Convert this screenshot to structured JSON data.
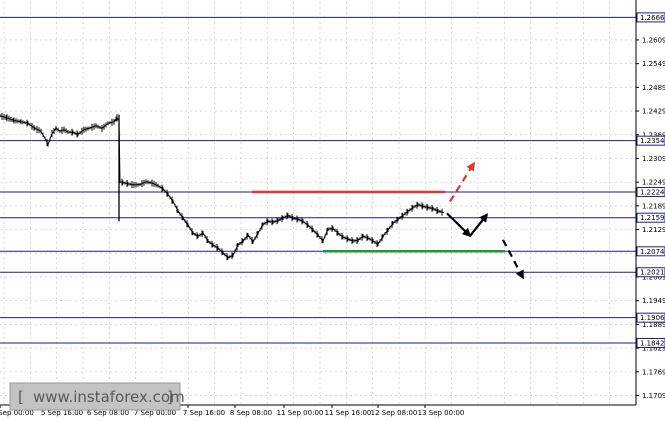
{
  "chart_data": {
    "type": "line",
    "title": "",
    "xlabel": "",
    "ylabel": "",
    "ylim": [
      1.1685,
      1.2705
    ],
    "y_ticks": [
      "1.2666",
      "1.2609",
      "1.2549",
      "1.2489",
      "1.2429",
      "1.2369",
      "1.2309",
      "1.2249",
      "1.2189",
      "1.2129",
      "1.2069",
      "1.2009",
      "1.1949",
      "1.1889",
      "1.1829",
      "1.1769",
      "1.1709"
    ],
    "x_ticks": [
      "4 Sep 00:00",
      "5 Sep 16:00",
      "6 Sep 08:00",
      "7 Sep 00:00",
      "7 Sep 16:00",
      "8 Sep 08:00",
      "11 Sep 00:00",
      "11 Sep 16:00",
      "12 Sep 08:00",
      "13 Sep 00:00"
    ],
    "x_tick_display": [
      "Sep 00:00",
      "5 Sep 16:00",
      "6 Sep 08:00",
      "7 Sep 00:00",
      "7 Sep 16:00",
      "8 Sep 08:00",
      "11 Sep 00:00",
      "11 Sep 16:00",
      "12 Sep 08:00",
      "13 Sep 00:00"
    ],
    "grid": true,
    "levels": [
      {
        "value": 1.2666,
        "label": "1.2666"
      },
      {
        "value": 1.2354,
        "label": "1.2354"
      },
      {
        "value": 1.2224,
        "label": "1.2224"
      },
      {
        "value": 1.2159,
        "label": "1.2159"
      },
      {
        "value": 1.2074,
        "label": "1.2074"
      },
      {
        "value": 1.2021,
        "label": "1.2021"
      },
      {
        "value": 1.1906,
        "label": "1.1906"
      },
      {
        "value": 1.1842,
        "label": "1.1842"
      }
    ],
    "price": [
      [
        0,
        1.2417
      ],
      [
        7,
        1.2412
      ],
      [
        14,
        1.2405
      ],
      [
        21,
        1.2402
      ],
      [
        28,
        1.2398
      ],
      [
        35,
        1.2385
      ],
      [
        41,
        1.2378
      ],
      [
        45,
        1.236
      ],
      [
        48,
        1.2344
      ],
      [
        52,
        1.2372
      ],
      [
        56,
        1.2385
      ],
      [
        60,
        1.2378
      ],
      [
        64,
        1.2382
      ],
      [
        68,
        1.2376
      ],
      [
        73,
        1.2375
      ],
      [
        78,
        1.237
      ],
      [
        84,
        1.2382
      ],
      [
        90,
        1.2386
      ],
      [
        96,
        1.2392
      ],
      [
        102,
        1.2385
      ],
      [
        108,
        1.2398
      ],
      [
        114,
        1.2402
      ],
      [
        117,
        1.2412
      ],
      [
        119,
        1.2405
      ],
      [
        120,
        1.225
      ],
      [
        123,
        1.2248
      ],
      [
        128,
        1.2245
      ],
      [
        134,
        1.2242
      ],
      [
        140,
        1.2243
      ],
      [
        146,
        1.225
      ],
      [
        152,
        1.2247
      ],
      [
        158,
        1.224
      ],
      [
        163,
        1.2232
      ],
      [
        168,
        1.2218
      ],
      [
        173,
        1.22
      ],
      [
        178,
        1.2176
      ],
      [
        183,
        1.2158
      ],
      [
        188,
        1.214
      ],
      [
        193,
        1.212
      ],
      [
        198,
        1.2112
      ],
      [
        203,
        1.212
      ],
      [
        208,
        1.21
      ],
      [
        213,
        1.209
      ],
      [
        218,
        1.2082
      ],
      [
        223,
        1.207
      ],
      [
        228,
        1.2058
      ],
      [
        233,
        1.2064
      ],
      [
        238,
        1.209
      ],
      [
        243,
        1.21
      ],
      [
        248,
        1.2115
      ],
      [
        253,
        1.2098
      ],
      [
        258,
        1.212
      ],
      [
        263,
        1.2142
      ],
      [
        268,
        1.215
      ],
      [
        273,
        1.2148
      ],
      [
        278,
        1.2152
      ],
      [
        283,
        1.2158
      ],
      [
        288,
        1.2165
      ],
      [
        293,
        1.2158
      ],
      [
        298,
        1.2155
      ],
      [
        303,
        1.215
      ],
      [
        308,
        1.214
      ],
      [
        313,
        1.2128
      ],
      [
        318,
        1.2115
      ],
      [
        323,
        1.21
      ],
      [
        328,
        1.213
      ],
      [
        333,
        1.2132
      ],
      [
        338,
        1.212
      ],
      [
        343,
        1.211
      ],
      [
        348,
        1.2105
      ],
      [
        353,
        1.21
      ],
      [
        358,
        1.2102
      ],
      [
        363,
        1.2112
      ],
      [
        368,
        1.2108
      ],
      [
        373,
        1.21
      ],
      [
        378,
        1.2092
      ],
      [
        383,
        1.2112
      ],
      [
        388,
        1.2128
      ],
      [
        393,
        1.2145
      ],
      [
        398,
        1.2155
      ],
      [
        403,
        1.2165
      ],
      [
        408,
        1.2175
      ],
      [
        413,
        1.2185
      ],
      [
        418,
        1.2192
      ],
      [
        423,
        1.2188
      ],
      [
        428,
        1.2185
      ],
      [
        433,
        1.2182
      ],
      [
        438,
        1.2176
      ],
      [
        444,
        1.2172
      ]
    ],
    "annotations": [
      {
        "kind": "segment",
        "color": "#e3342f",
        "x1": 252,
        "x2": 445,
        "y": 1.2224
      },
      {
        "kind": "segment",
        "color": "#1f9a3a",
        "x1": 323,
        "x2": 505,
        "y": 1.2074
      },
      {
        "kind": "arrow",
        "color": "#e3342f",
        "dashed": true,
        "x1": 450,
        "y1": 1.22,
        "x2": 474,
        "y2": 1.2297
      },
      {
        "kind": "arrow",
        "color": "#000000",
        "dashed": false,
        "x1": 447,
        "y1": 1.217,
        "x2": 470,
        "y2": 1.2113
      },
      {
        "kind": "arrow",
        "color": "#000000",
        "dashed": false,
        "x1": 470,
        "y1": 1.2113,
        "x2": 487,
        "y2": 1.2167
      },
      {
        "kind": "arrow",
        "color": "#000000",
        "dashed": true,
        "x1": 503,
        "y1": 1.2103,
        "x2": 523,
        "y2": 1.2007
      }
    ]
  },
  "watermark": {
    "text": "www.instaforex.com",
    "open_bracket": "[",
    "close_bracket": "]",
    "background": "#c3c3c3"
  },
  "colors": {
    "level_line": "#1e1e8c",
    "grid": "#c8c8c8",
    "price": "#000000",
    "support": "#1f9a3a",
    "resistance": "#e3342f"
  }
}
